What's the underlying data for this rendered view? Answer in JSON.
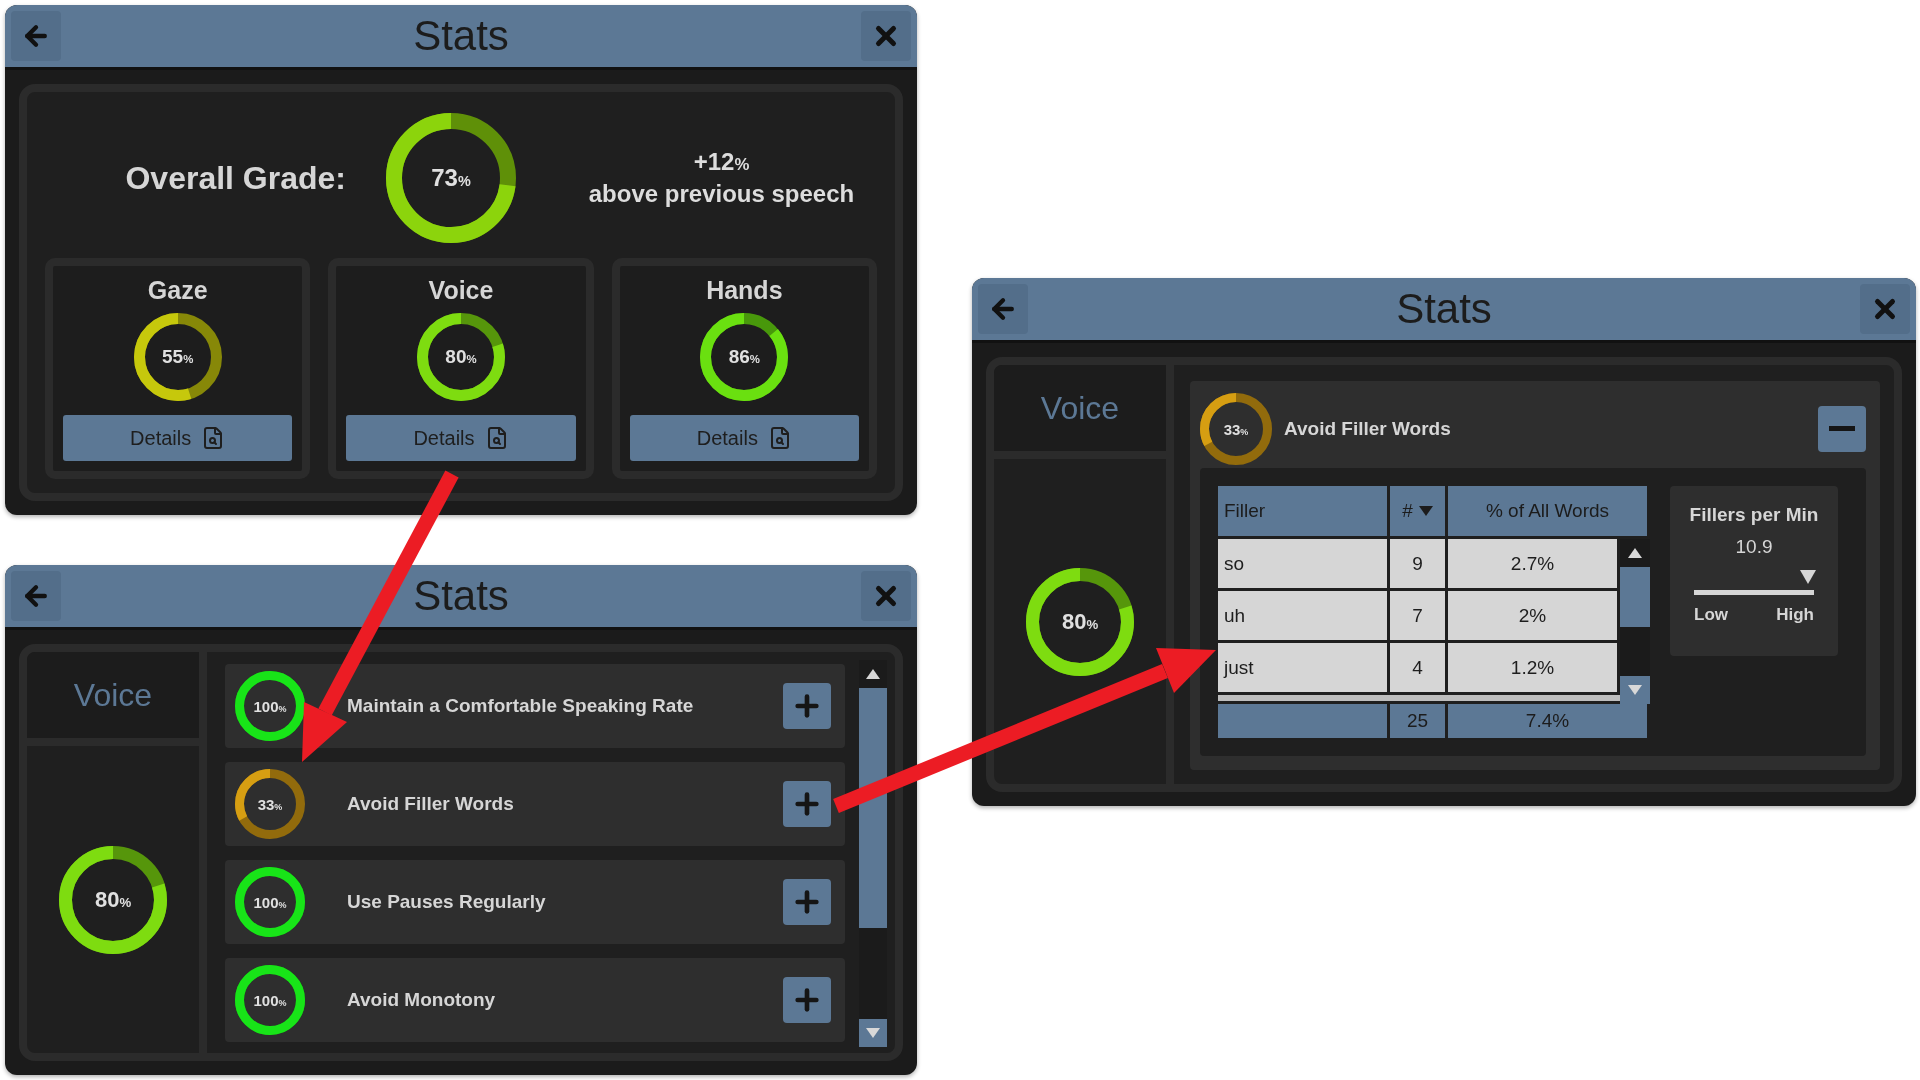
{
  "windows": [
    {
      "kind": "overview",
      "title": "Stats",
      "overall": {
        "label": "Overall Grade:",
        "value": "73",
        "unit": "%",
        "level": 0.73,
        "color": "#8cd40c"
      },
      "change": {
        "value": "+12",
        "unit": "%",
        "caption": "above previous speech"
      },
      "categories": [
        {
          "name": "Gaze",
          "value": "55",
          "unit": "%",
          "level": 0.55,
          "color": "#c6c80c",
          "button": "Details"
        },
        {
          "name": "Voice",
          "value": "80",
          "unit": "%",
          "level": 0.8,
          "color": "#7edc10",
          "button": "Details"
        },
        {
          "name": "Hands",
          "value": "86",
          "unit": "%",
          "level": 0.86,
          "color": "#6ae010",
          "button": "Details"
        }
      ]
    },
    {
      "kind": "category",
      "title": "Stats",
      "category": {
        "name": "Voice",
        "value": "80",
        "unit": "%",
        "level": 0.8,
        "color": "#7edc10"
      },
      "goals": [
        {
          "title": "Maintain a Comfortable Speaking Rate",
          "value": "100",
          "unit": "%",
          "level": 1,
          "color": "#18e418",
          "expanded": false
        },
        {
          "title": "Avoid Filler Words",
          "value": "33",
          "unit": "%",
          "level": 0.33,
          "color": "#d69e12",
          "expanded": false
        },
        {
          "title": "Use Pauses Regularly",
          "value": "100",
          "unit": "%",
          "level": 1,
          "color": "#18e418",
          "expanded": false
        },
        {
          "title": "Avoid Monotony",
          "value": "100",
          "unit": "%",
          "level": 1,
          "color": "#18e418",
          "expanded": false
        }
      ]
    },
    {
      "kind": "detail",
      "title": "Stats",
      "category": {
        "name": "Voice",
        "value": "80",
        "unit": "%",
        "level": 0.8,
        "color": "#7edc10"
      },
      "goal": {
        "title": "Avoid Filler Words",
        "value": "33",
        "unit": "%",
        "level": 0.33,
        "color": "#d69e12",
        "expanded": true
      },
      "table": {
        "columns": [
          {
            "label": "Filler",
            "sorted": false
          },
          {
            "label": "#",
            "sorted": true
          },
          {
            "label": "% of All Words",
            "sorted": false
          }
        ],
        "rows": [
          [
            "so",
            "9",
            "2.7%"
          ],
          [
            "uh",
            "7",
            "2%"
          ],
          [
            "just",
            "4",
            "1.2%"
          ]
        ],
        "totals": [
          "25",
          "7.4%"
        ]
      },
      "rate": {
        "label": "Fillers per Min",
        "value": "10.9",
        "level": 0.95,
        "low": "Low",
        "high": "High"
      }
    }
  ]
}
